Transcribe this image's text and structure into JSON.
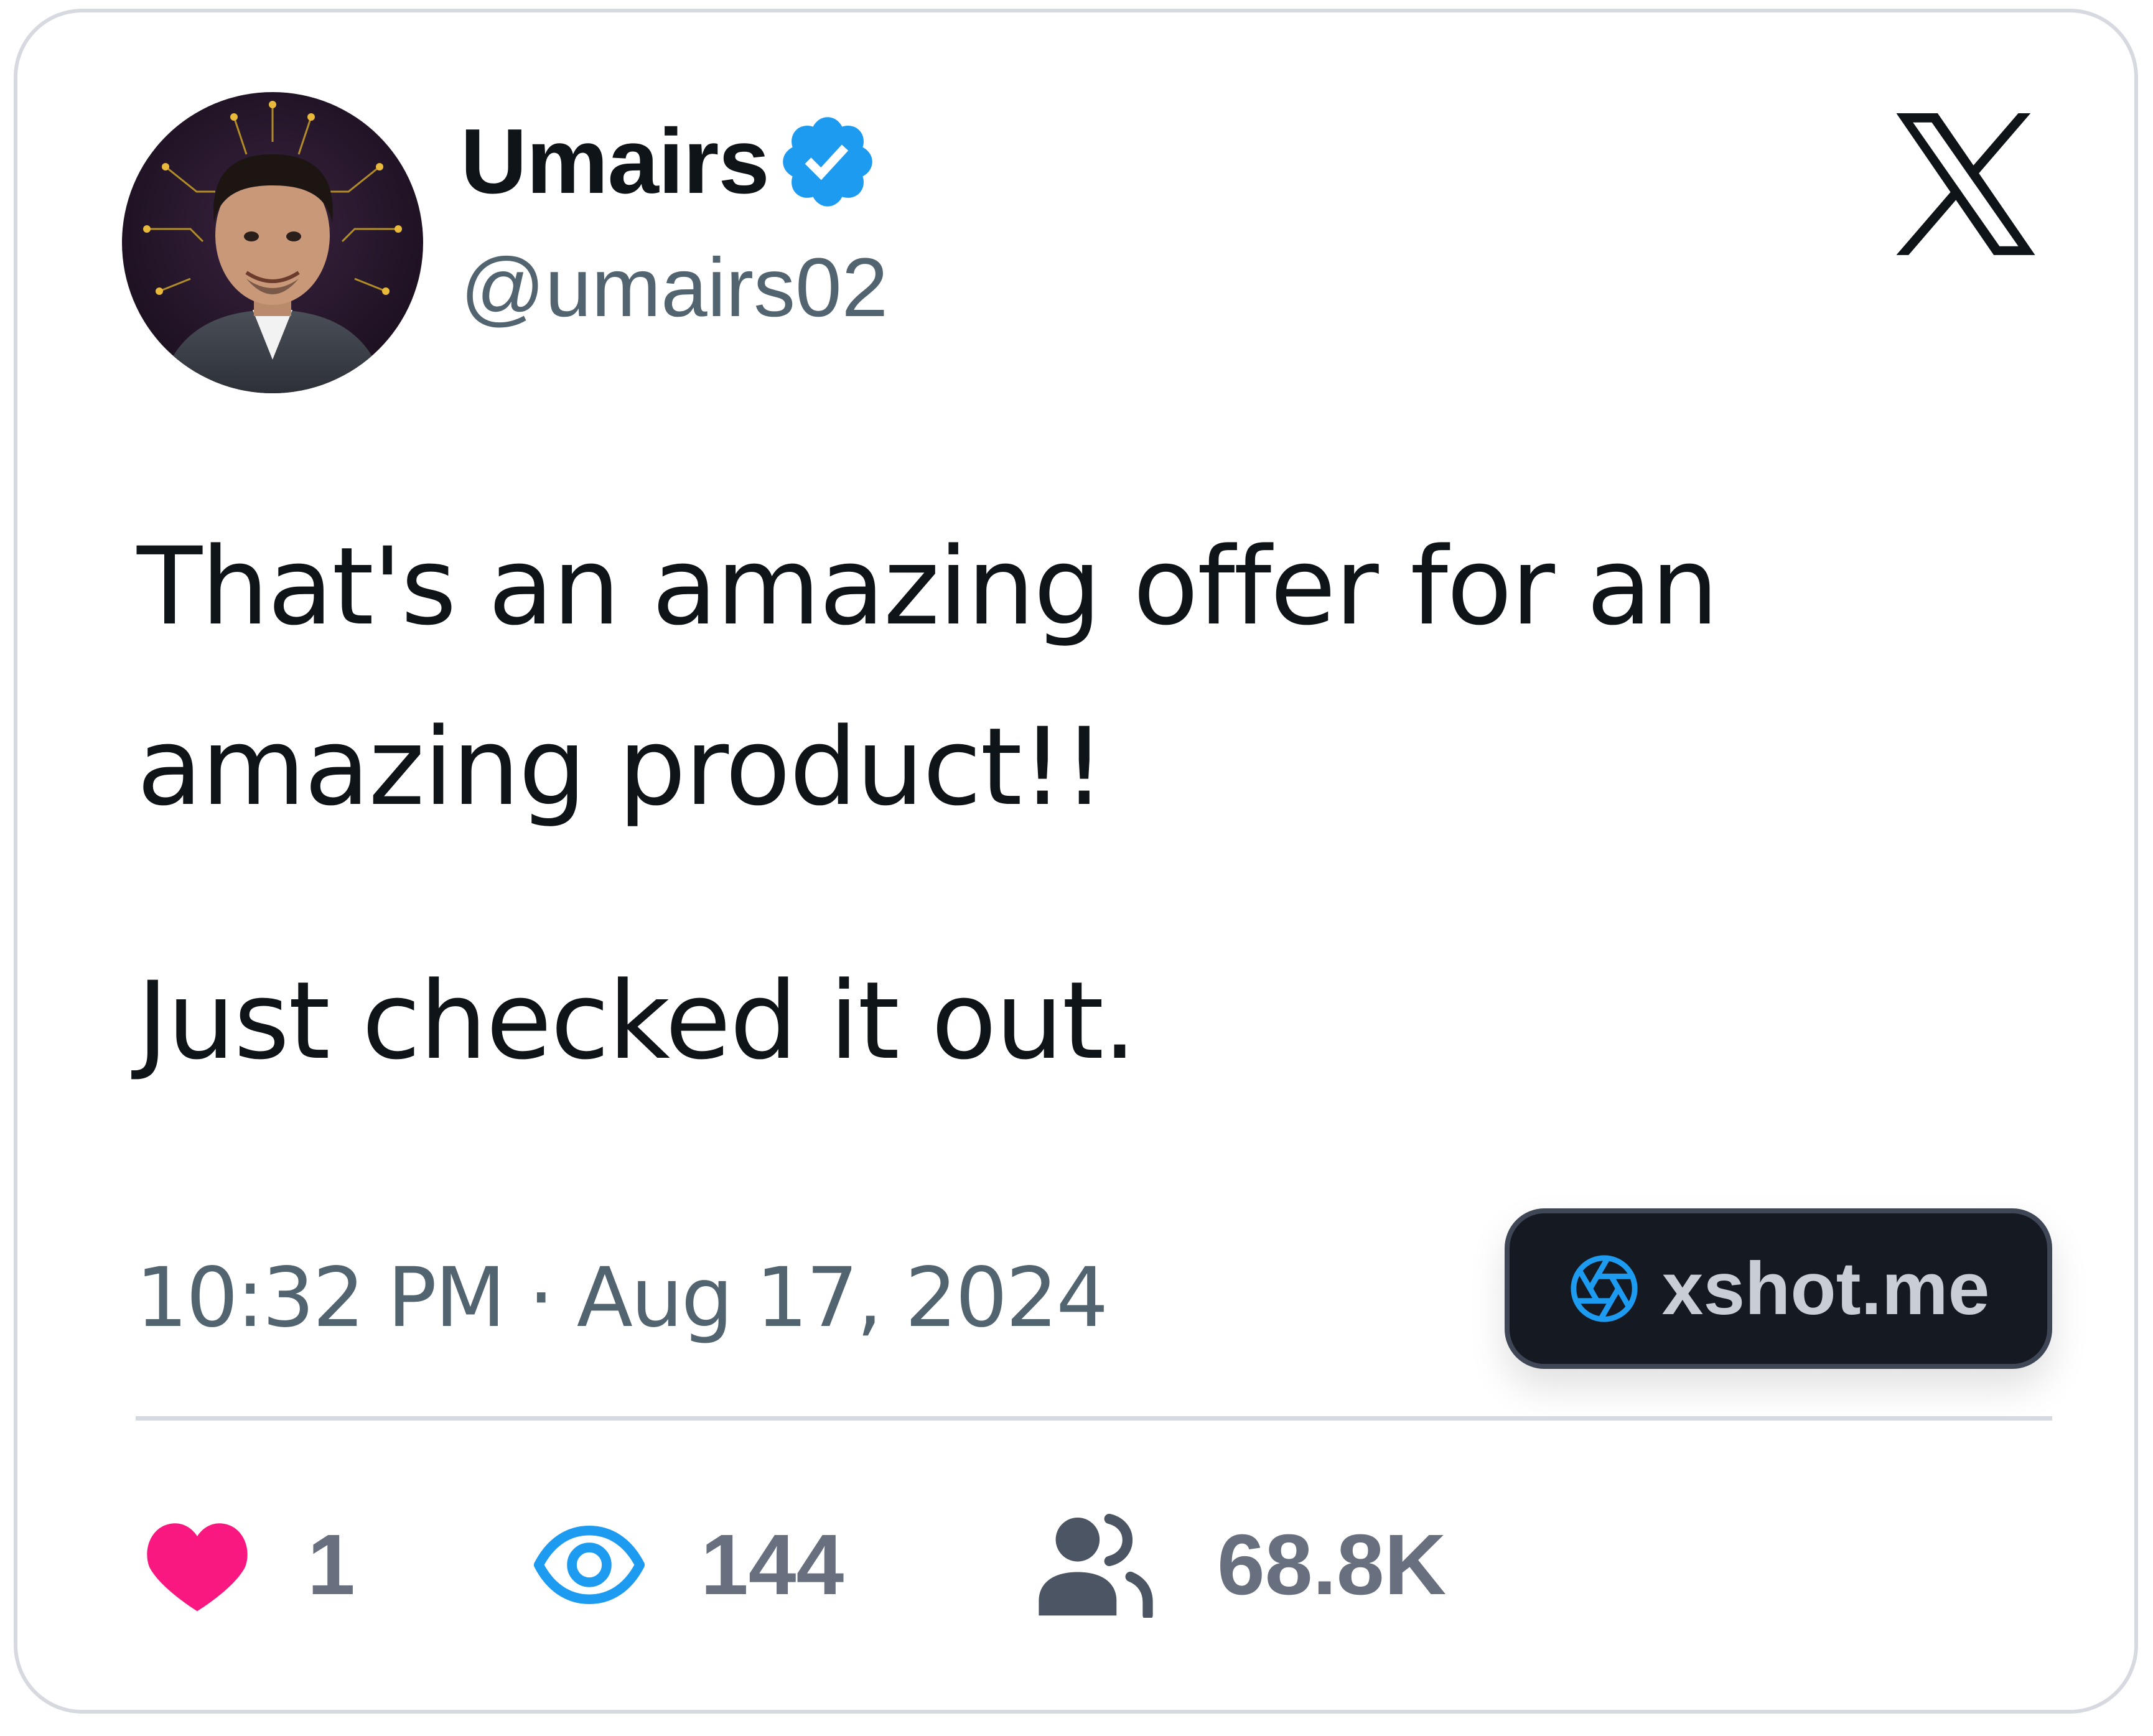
{
  "author": {
    "display_name": "Umairs",
    "handle": "@umairs02",
    "verified": true,
    "avatar": "profile-photo"
  },
  "tweet": {
    "paragraphs": [
      "That's an amazing offer for an amazing product!!",
      "Just checked it out."
    ],
    "timestamp": "10:32 PM · Aug 17, 2024"
  },
  "watermark": {
    "label": "xshot.me",
    "icon": "camera-aperture-icon"
  },
  "stats": {
    "likes": "1",
    "views": "144",
    "followers": "68.8K"
  },
  "colors": {
    "verified": "#1d9bf0",
    "heart": "#f91880",
    "views": "#1d9bf0",
    "text": "#0f1419",
    "secondary_text": "#536471"
  }
}
